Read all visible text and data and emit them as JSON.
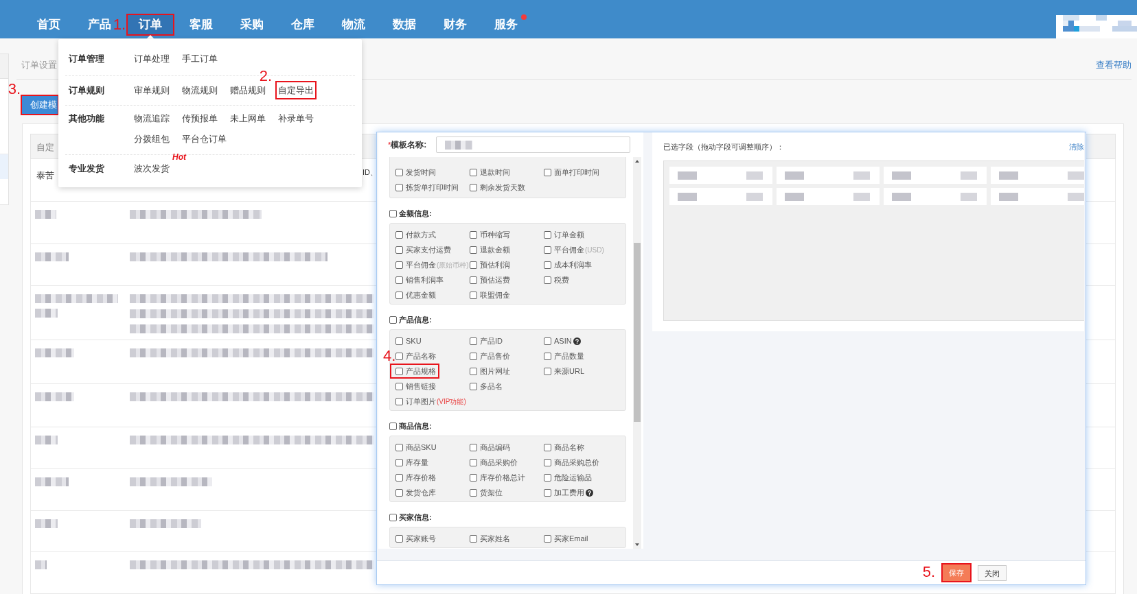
{
  "top_nav": {
    "tabs": [
      {
        "label": "首页",
        "selected": false,
        "dot": false
      },
      {
        "label": "产品",
        "selected": false,
        "dot": false
      },
      {
        "label": "订单",
        "selected": true,
        "dot": false,
        "step": "1."
      },
      {
        "label": "客服",
        "selected": false,
        "dot": false
      },
      {
        "label": "采购",
        "selected": false,
        "dot": false
      },
      {
        "label": "仓库",
        "selected": false,
        "dot": false
      },
      {
        "label": "物流",
        "selected": false,
        "dot": false
      },
      {
        "label": "数据",
        "selected": false,
        "dot": false
      },
      {
        "label": "财务",
        "selected": false,
        "dot": false
      },
      {
        "label": "服务",
        "selected": false,
        "dot": true
      }
    ]
  },
  "order_menu": {
    "groups": [
      {
        "title": "订单管理",
        "items": [
          {
            "label": "订单处理"
          },
          {
            "label": "手工订单"
          }
        ]
      },
      {
        "title": "订单规则",
        "items": [
          {
            "label": "审单规则"
          },
          {
            "label": "物流规则"
          },
          {
            "label": "赠品规则"
          },
          {
            "label": "自定导出",
            "step": "2."
          }
        ]
      },
      {
        "title": "其他功能",
        "items": [
          {
            "label": "物流追踪"
          },
          {
            "label": "传预报单"
          },
          {
            "label": "未上网单"
          },
          {
            "label": "补录单号"
          },
          {
            "label": "分拨组包"
          },
          {
            "label": "平台仓订单"
          }
        ]
      },
      {
        "title": "专业发货",
        "items": [
          {
            "label": "波次发货",
            "badge": "Hot"
          }
        ]
      }
    ]
  },
  "page": {
    "breadcrumb": "订单设置",
    "help_link": "查看帮助",
    "create_button": {
      "label": "创建模",
      "step": "3."
    }
  },
  "table": {
    "columns": [
      "自定"
    ],
    "rows": [
      {
        "cells": [
          "泰苦",
          "ID、"
        ]
      }
    ]
  },
  "export_dialog": {
    "name_field": {
      "required_mark": "*",
      "label": "模板名称:"
    },
    "sections": [
      {
        "rows": [
          [
            {
              "label": "发货时间",
              "checked": false
            },
            {
              "label": "退款时间",
              "checked": false
            },
            {
              "label": "面单打印时间",
              "checked": false
            }
          ],
          [
            {
              "label": "拣货单打印时间",
              "checked": false
            },
            {
              "label": "剩余发货天数",
              "checked": false
            }
          ]
        ]
      },
      {
        "title": "金额信息:",
        "checked": false,
        "rows": [
          [
            {
              "label": "付款方式",
              "checked": false
            },
            {
              "label": "币种缩写",
              "checked": false
            },
            {
              "label": "订单金额",
              "checked": false
            }
          ],
          [
            {
              "label": "买家支付运费",
              "checked": false
            },
            {
              "label": "退款金额",
              "checked": false
            },
            {
              "label": "平台佣金",
              "note": {
                "text": "(USD)",
                "color": "#aaaaaa"
              },
              "checked": false
            }
          ],
          [
            {
              "label": "平台佣金",
              "note": {
                "text": "(原始币种)",
                "color": "#aaaaaa"
              },
              "checked": false
            },
            {
              "label": "预估利润",
              "checked": false
            },
            {
              "label": "成本利润率",
              "checked": false
            }
          ],
          [
            {
              "label": "销售利润率",
              "checked": false
            },
            {
              "label": "预估运费",
              "checked": false
            },
            {
              "label": "税费",
              "checked": false
            }
          ],
          [
            {
              "label": "优惠金额",
              "checked": false
            },
            {
              "label": "联盟佣金",
              "checked": false
            }
          ]
        ]
      },
      {
        "title": "产品信息:",
        "checked": false,
        "rows": [
          [
            {
              "label": "SKU",
              "checked": false,
              "help": false
            },
            {
              "label": "产品ID",
              "checked": false,
              "help": false
            },
            {
              "label": "ASIN",
              "checked": false,
              "help": true
            }
          ],
          [
            {
              "label": "产品名称",
              "checked": false,
              "help": false
            },
            {
              "label": "产品售价",
              "checked": false,
              "help": false
            },
            {
              "label": "产品数量",
              "checked": false,
              "help": false
            }
          ],
          [
            {
              "label": "产品规格",
              "checked": false,
              "help": false,
              "step": "4."
            },
            {
              "label": "图片网址",
              "checked": false,
              "help": false
            },
            {
              "label": "来源URL",
              "checked": false,
              "help": false
            }
          ],
          [
            {
              "label": "销售链接",
              "checked": false,
              "help": false
            },
            {
              "label": "多品名",
              "checked": false,
              "help": false
            }
          ],
          [
            {
              "label": "订单图片",
              "note": {
                "text": "(VIP功能)",
                "color": "#e84040"
              },
              "checked": false,
              "help": false
            }
          ]
        ]
      },
      {
        "title": "商品信息:",
        "checked": false,
        "rows": [
          [
            {
              "label": "商品SKU",
              "checked": false,
              "help": false
            },
            {
              "label": "商品编码",
              "checked": false,
              "help": false
            },
            {
              "label": "商品名称",
              "checked": false,
              "help": false
            }
          ],
          [
            {
              "label": "库存量",
              "checked": false,
              "help": false
            },
            {
              "label": "商品采购价",
              "checked": false,
              "help": false
            },
            {
              "label": "商品采购总价",
              "checked": false,
              "help": false
            }
          ],
          [
            {
              "label": "库存价格",
              "checked": false,
              "help": false
            },
            {
              "label": "库存价格总计",
              "checked": false,
              "help": false
            },
            {
              "label": "危险运输品",
              "checked": false,
              "help": false
            }
          ],
          [
            {
              "label": "发货仓库",
              "checked": false,
              "help": false
            },
            {
              "label": "货架位",
              "checked": false,
              "help": false
            },
            {
              "label": "加工费用",
              "checked": false,
              "help": true
            }
          ]
        ]
      },
      {
        "title": "买家信息:",
        "checked": false,
        "rows": [
          [
            {
              "label": "买家账号",
              "checked": false
            },
            {
              "label": "买家姓名",
              "checked": false
            },
            {
              "label": "买家Email",
              "checked": false
            }
          ]
        ]
      }
    ],
    "selected_fields": {
      "title": "已选字段（拖动字段可调整顺序）：",
      "clear_link": "清除"
    },
    "buttons": [
      {
        "label": "保存",
        "kind": "primary",
        "step": "5."
      },
      {
        "label": "关闭",
        "kind": "secondary"
      }
    ]
  }
}
